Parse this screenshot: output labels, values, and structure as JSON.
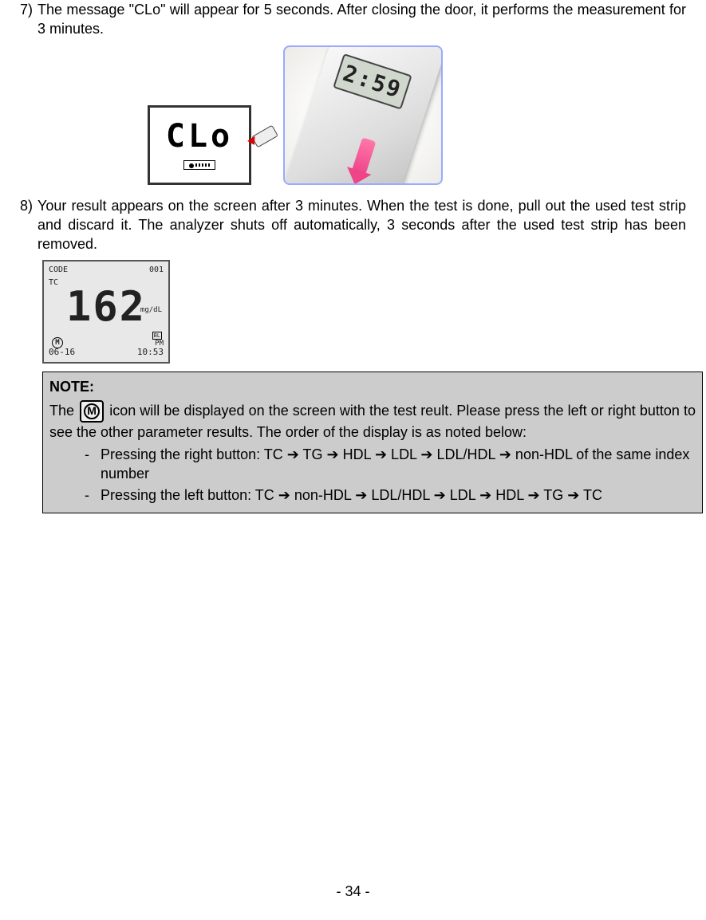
{
  "step7": {
    "num": "7)",
    "text": "The message \"CLo\" will appear for 5 seconds. After closing the door, it performs the measurement for 3 minutes.",
    "clo_label": "CLo",
    "device_countdown": "2:59"
  },
  "step8": {
    "num": "8)",
    "text": "Your result appears on the screen after 3 minutes. When the test is done, pull out the used test strip and discard it. The analyzer shuts off automatically, 3 seconds after the used test strip has been removed.",
    "result": {
      "code_label": "CODE",
      "code_value": "001",
      "tc_label": "TC",
      "main_value": "162",
      "unit": "mg/dL",
      "m_icon": "M",
      "bl_label": "BL",
      "date": "06-16",
      "ampm": "PM",
      "time": "10:53"
    }
  },
  "note": {
    "title": "NOTE:",
    "icon_letter": "M",
    "body_before": "The ",
    "body_after": " icon will be displayed on the screen with the test reult. Please press the left or right button to see the other parameter results. The order of the display is as noted below:",
    "items": [
      {
        "dash": "-",
        "text": "Pressing the right button: TC ➔ TG ➔ HDL ➔ LDL ➔ LDL/HDL ➔ non-HDL of the same index number"
      },
      {
        "dash": "-",
        "text": "Pressing the left button: TC ➔ non-HDL ➔ LDL/HDL ➔ LDL ➔ HDL ➔ TG ➔ TC"
      }
    ]
  },
  "page_number": "- 34 -"
}
